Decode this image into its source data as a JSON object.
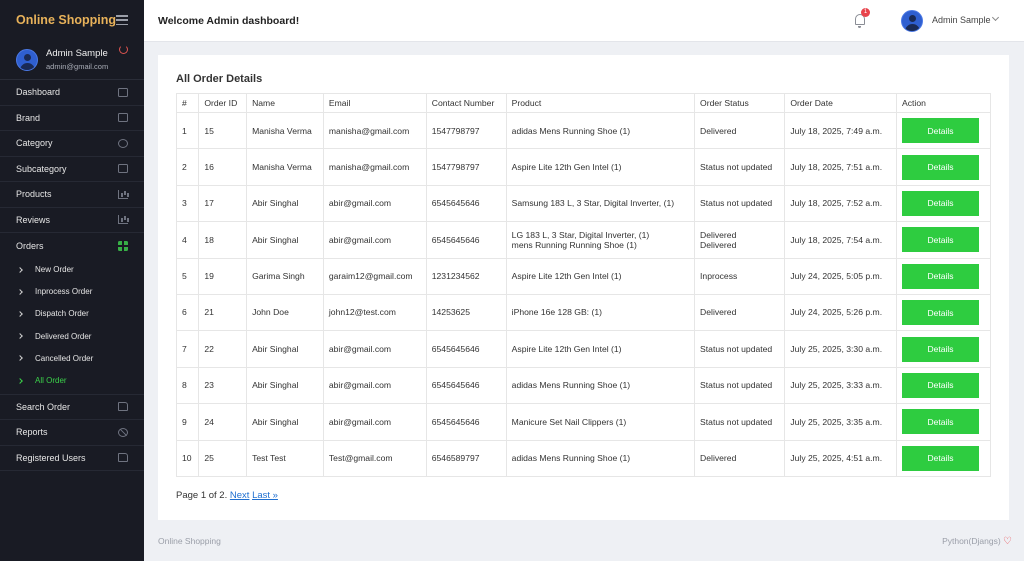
{
  "sidebar": {
    "brand": "Online Shopping",
    "profile": {
      "name": "Admin Sample",
      "email": "admin@gmail.com"
    },
    "menu_top": [
      {
        "label": "Dashboard",
        "icon": "monitor-icon"
      },
      {
        "label": "Brand",
        "icon": "box-icon"
      },
      {
        "label": "Category",
        "icon": "globe-icon"
      },
      {
        "label": "Subcategory",
        "icon": "calendar-icon"
      },
      {
        "label": "Products",
        "icon": "bar-chart-icon"
      },
      {
        "label": "Reviews",
        "icon": "bar-chart-icon"
      },
      {
        "label": "Orders",
        "icon": "grid-icon"
      }
    ],
    "orders_sub": [
      {
        "label": "New Order"
      },
      {
        "label": "Inprocess Order"
      },
      {
        "label": "Dispatch Order"
      },
      {
        "label": "Delivered Order"
      },
      {
        "label": "Cancelled Order"
      },
      {
        "label": "All Order",
        "active": true
      }
    ],
    "menu_bottom": [
      {
        "label": "Search Order",
        "icon": "folder-icon"
      },
      {
        "label": "Reports",
        "icon": "ban-icon"
      },
      {
        "label": "Registered Users",
        "icon": "folder-icon"
      }
    ]
  },
  "header": {
    "welcome": "Welcome Admin dashboard!",
    "notification_count": "1",
    "user": "Admin Sample"
  },
  "main": {
    "title": "All Order Details",
    "columns": [
      "#",
      "Order ID",
      "Name",
      "Email",
      "Contact Number",
      "Product",
      "Order Status",
      "Order Date",
      "Action"
    ],
    "button_label": "Details",
    "rows": [
      [
        "1",
        "15",
        "Manisha Verma",
        "manisha@gmail.com",
        "1547798797",
        "adidas Mens Running Shoe (1)",
        "Delivered",
        "July 18, 2025, 7:49 a.m."
      ],
      [
        "2",
        "16",
        "Manisha Verma",
        "manisha@gmail.com",
        "1547798797",
        "Aspire Lite 12th Gen Intel (1)",
        "Status not updated",
        "July 18, 2025, 7:51 a.m."
      ],
      [
        "3",
        "17",
        "Abir Singhal",
        "abir@gmail.com",
        "6545645646",
        "Samsung 183 L, 3 Star, Digital Inverter, (1)",
        "Status not updated",
        "July 18, 2025, 7:52 a.m."
      ],
      [
        "4",
        "18",
        "Abir Singhal",
        "abir@gmail.com",
        "6545645646",
        "LG 183 L, 3 Star, Digital Inverter, (1)\nmens Running Running Shoe (1)",
        "Delivered\nDelivered",
        "July 18, 2025, 7:54 a.m."
      ],
      [
        "5",
        "19",
        "Garima Singh",
        "garaim12@gmail.com",
        "1231234562",
        "Aspire Lite 12th Gen Intel (1)",
        "Inprocess",
        "July 24, 2025, 5:05 p.m."
      ],
      [
        "6",
        "21",
        "John Doe",
        "john12@test.com",
        "14253625",
        "iPhone 16e 128 GB: (1)",
        "Delivered",
        "July 24, 2025, 5:26 p.m."
      ],
      [
        "7",
        "22",
        "Abir Singhal",
        "abir@gmail.com",
        "6545645646",
        "Aspire Lite 12th Gen Intel (1)",
        "Status not updated",
        "July 25, 2025, 3:30 a.m."
      ],
      [
        "8",
        "23",
        "Abir Singhal",
        "abir@gmail.com",
        "6545645646",
        "adidas Mens Running Shoe (1)",
        "Status not updated",
        "July 25, 2025, 3:33 a.m."
      ],
      [
        "9",
        "24",
        "Abir Singhal",
        "abir@gmail.com",
        "6545645646",
        "Manicure Set Nail Clippers (1)",
        "Status not updated",
        "July 25, 2025, 3:35 a.m."
      ],
      [
        "10",
        "25",
        "Test Test",
        "Test@gmail.com",
        "6546589797",
        "adidas Mens Running Shoe (1)",
        "Delivered",
        "July 25, 2025, 4:51 a.m."
      ]
    ],
    "pager": {
      "text": "Page 1 of 2.",
      "next": "Next",
      "last": "Last »"
    }
  },
  "footer": {
    "left": "Online Shopping",
    "right": "Python(Djangs)"
  },
  "colors": {
    "sidebar_bg": "#191b24",
    "brand": "#e8b25a",
    "accent_green": "#2ecc40",
    "active_green": "#3bd14a",
    "badge_red": "#e8434b",
    "link_blue": "#1f6fd0"
  }
}
